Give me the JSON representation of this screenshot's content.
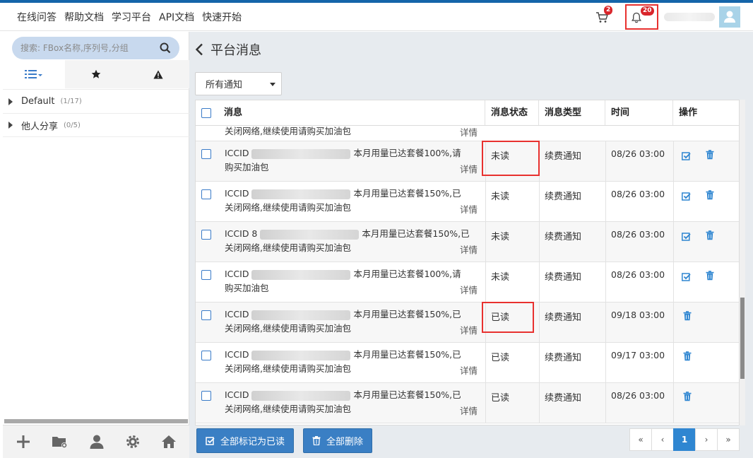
{
  "topnav": [
    "在线问答",
    "帮助文档",
    "学习平台",
    "API文档",
    "快速开始"
  ],
  "header": {
    "cart_count": "2",
    "notification_count": "20"
  },
  "sidebar": {
    "search_placeholder": "搜索: FBox名称,序列号,分组",
    "tabs": [
      "list-icon",
      "star-icon",
      "warning-icon"
    ],
    "groups": [
      {
        "name": "Default",
        "count": "(1/17)"
      },
      {
        "name": "他人分享",
        "count": "(0/5)"
      }
    ],
    "footer_icons": [
      "plus-icon",
      "folder-settings-icon",
      "user-icon",
      "gear-icon",
      "home-icon"
    ]
  },
  "page": {
    "title": "平台消息",
    "filter_value": "所有通知"
  },
  "table": {
    "columns": [
      "消息",
      "消息状态",
      "消息类型",
      "时间",
      "操作"
    ],
    "detail_label": "详情",
    "partial_row": {
      "line": "关闭网络,继续使用请购买加油包"
    },
    "rows": [
      {
        "prefix": "ICCID",
        "line1": "本月用量已达套餐100%,请",
        "line2": "购买加油包",
        "status": "未读",
        "type": "续费通知",
        "time": "08/26 03:00",
        "read": false
      },
      {
        "prefix": "ICCID",
        "line1": "本月用量已达套餐150%,已",
        "line2": "关闭网络,继续使用请购买加油包",
        "status": "未读",
        "type": "续费通知",
        "time": "08/26 03:00",
        "read": false
      },
      {
        "prefix": "ICCID 8",
        "line1": "本月用量已达套餐150%,已",
        "line2": "关闭网络,继续使用请购买加油包",
        "status": "未读",
        "type": "续费通知",
        "time": "08/26 03:00",
        "read": false
      },
      {
        "prefix": "ICCID",
        "line1": "本月用量已达套餐100%,请",
        "line2": "购买加油包",
        "status": "未读",
        "type": "续费通知",
        "time": "08/26 03:00",
        "read": false
      },
      {
        "prefix": "ICCID",
        "line1": "本月用量已达套餐150%,已",
        "line2": "关闭网络,继续使用请购买加油包",
        "status": "已读",
        "type": "续费通知",
        "time": "09/18 03:00",
        "read": true
      },
      {
        "prefix": "ICCID",
        "line1": "本月用量已达套餐150%,已",
        "line2": "关闭网络,继续使用请购买加油包",
        "status": "已读",
        "type": "续费通知",
        "time": "09/17 03:00",
        "read": true
      },
      {
        "prefix": "ICCID",
        "line1": "本月用量已达套餐150%,已",
        "line2": "关闭网络,继续使用请购买加油包",
        "status": "已读",
        "type": "续费通知",
        "time": "08/26 03:00",
        "read": true
      }
    ]
  },
  "actions": {
    "mark_all_read": "全部标记为已读",
    "delete_all": "全部删除"
  },
  "pagination": {
    "first": "«",
    "prev": "‹",
    "current": "1",
    "next": "›",
    "last": "»"
  },
  "colors": {
    "accent": "#3a7fc4",
    "highlight": "#e8312f",
    "badge": "#d9262b"
  }
}
